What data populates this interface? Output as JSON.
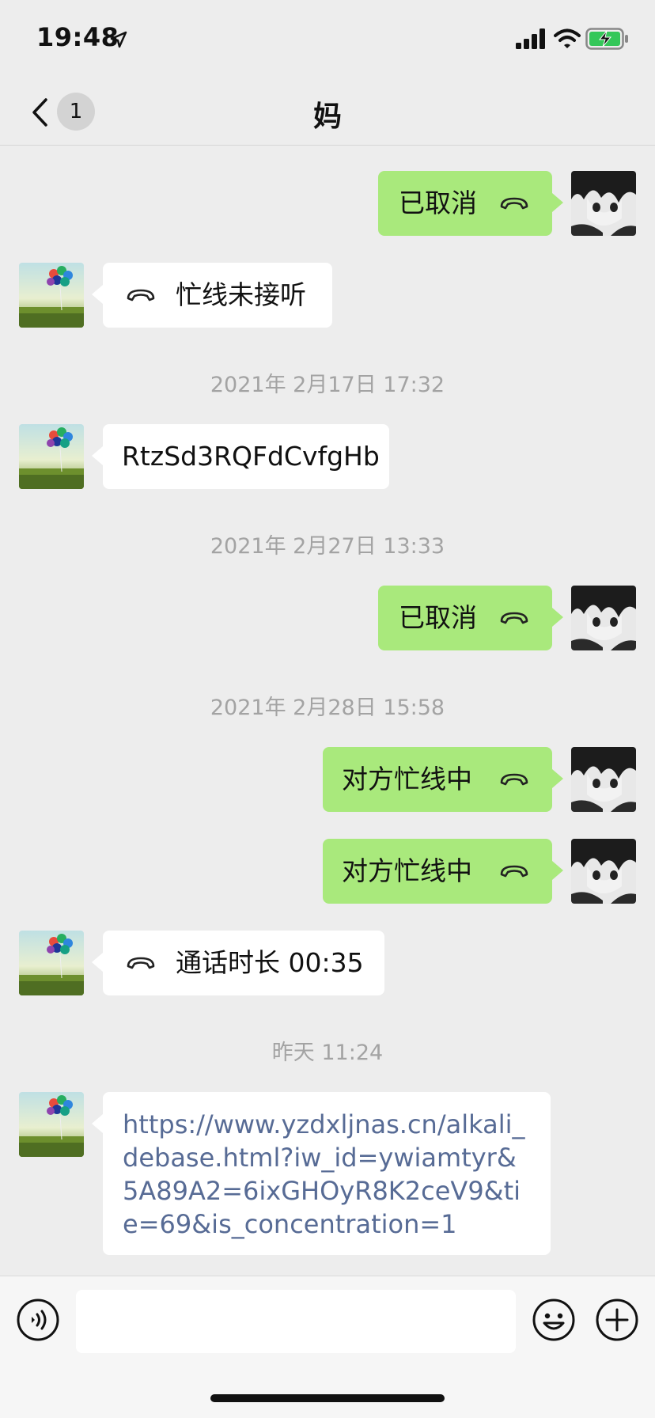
{
  "status_bar": {
    "time": "19:48",
    "icons": [
      "location-arrow-icon",
      "signal-icon",
      "wifi-icon",
      "battery-charging-icon"
    ]
  },
  "nav": {
    "back_icon": "chevron-left-icon",
    "unread_count": "1",
    "title": "妈",
    "more_icon": "more-dots-icon"
  },
  "messages": [
    {
      "side": "out",
      "kind": "call",
      "text": "已取消",
      "icon": "phone-hangup-icon"
    },
    {
      "side": "in",
      "kind": "call",
      "text": "忙线未接听",
      "icon": "phone-hangup-icon"
    },
    {
      "kind": "timestamp",
      "text": "2021年 2月17日 17:32"
    },
    {
      "side": "in",
      "kind": "text",
      "text": "RtzSd3RQFdCvfgHb"
    },
    {
      "kind": "timestamp",
      "text": "2021年 2月27日 13:33"
    },
    {
      "side": "out",
      "kind": "call",
      "text": "已取消",
      "icon": "phone-hangup-icon"
    },
    {
      "kind": "timestamp",
      "text": "2021年 2月28日 15:58"
    },
    {
      "side": "out",
      "kind": "call",
      "text": "对方忙线中",
      "icon": "phone-hangup-icon"
    },
    {
      "side": "out",
      "kind": "call",
      "text": "对方忙线中",
      "icon": "phone-hangup-icon"
    },
    {
      "side": "in",
      "kind": "call",
      "text": "通话时长 00:35",
      "icon": "phone-hangup-icon"
    },
    {
      "kind": "timestamp",
      "text": "昨天 11:24"
    },
    {
      "side": "in",
      "kind": "link",
      "text": "https://www.yzdxljnas.cn/alkali_debase.html?iw_id=ywiamtyr&5A89A2=6ixGHOyR8K2ceV9&tie=69&is_concentration=1"
    }
  ],
  "input_bar": {
    "voice_icon": "voice-icon",
    "emoji_icon": "emoji-icon",
    "plus_icon": "plus-circle-icon"
  },
  "colors": {
    "background": "#ededed",
    "outgoing_bubble": "#a9e97c",
    "incoming_bubble": "#ffffff",
    "link": "#576b95",
    "timestamp": "#a3a3a3"
  }
}
